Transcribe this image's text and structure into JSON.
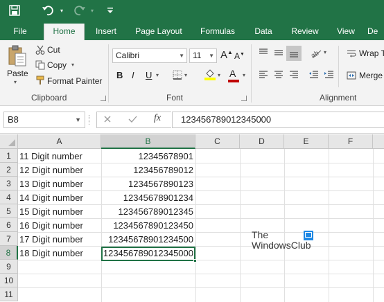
{
  "tabs": [
    "File",
    "Home",
    "Insert",
    "Page Layout",
    "Formulas",
    "Data",
    "Review",
    "View",
    "De"
  ],
  "active_tab": "Home",
  "clipboard": {
    "paste_label": "Paste",
    "cut_label": "Cut",
    "copy_label": "Copy",
    "format_painter_label": "Format Painter",
    "group_label": "Clipboard"
  },
  "font": {
    "name": "Calibri",
    "size": "11",
    "bold": "B",
    "italic": "I",
    "underline": "U",
    "font_color_letter": "A",
    "grow_letter": "A",
    "shrink_letter": "A",
    "group_label": "Font"
  },
  "alignment": {
    "wrap_text_label": "Wrap T",
    "merge_label": "Merge",
    "group_label": "Alignment"
  },
  "formula_bar": {
    "name_box": "B8",
    "fx": "fx",
    "formula": "123456789012345000"
  },
  "columns": [
    "A",
    "B",
    "C",
    "D",
    "E",
    "F"
  ],
  "rows": [
    "1",
    "2",
    "3",
    "4",
    "5",
    "6",
    "7",
    "8",
    "9",
    "10",
    "11"
  ],
  "cells": [
    {
      "a": "11 Digit number",
      "b": "12345678901"
    },
    {
      "a": "12 Digit number",
      "b": "123456789012"
    },
    {
      "a": "13 Digit number",
      "b": "1234567890123"
    },
    {
      "a": "14 Digit number",
      "b": "12345678901234"
    },
    {
      "a": "15 Digit number",
      "b": "123456789012345"
    },
    {
      "a": "16 Digit number",
      "b": "1234567890123450"
    },
    {
      "a": "17 Digit number",
      "b": "12345678901234500"
    },
    {
      "a": "18 Digit number",
      "b": "123456789012345000"
    }
  ],
  "watermark": {
    "line1": "The",
    "line2": "WindowsClub"
  },
  "colors": {
    "accent": "#217346",
    "font_color_bar": "#c00000",
    "highlight_bar": "#ffff00"
  }
}
